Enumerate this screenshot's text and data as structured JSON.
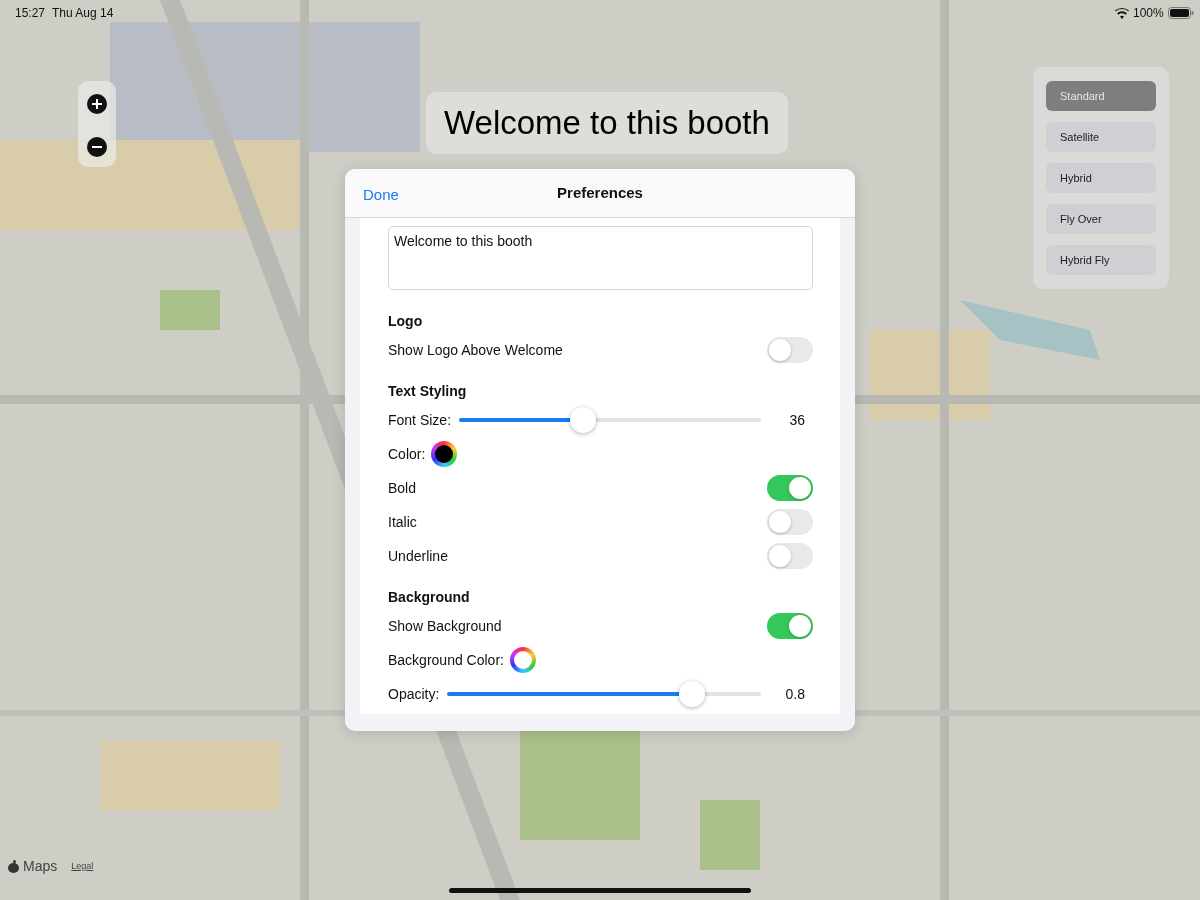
{
  "status_bar": {
    "time": "15:27",
    "date": "Thu Aug 14",
    "battery": "100%"
  },
  "banner": {
    "text": "Welcome to this booth"
  },
  "map_types": [
    {
      "label": "Standard",
      "selected": true
    },
    {
      "label": "Satellite",
      "selected": false
    },
    {
      "label": "Hybrid",
      "selected": false
    },
    {
      "label": "Fly Over",
      "selected": false
    },
    {
      "label": "Hybrid Fly",
      "selected": false
    }
  ],
  "preferences": {
    "done": "Done",
    "title": "Preferences",
    "welcome_text": "Welcome to this booth",
    "sections": [
      {
        "heading": "Logo",
        "rows": [
          {
            "kind": "toggle",
            "label": "Show Logo Above Welcome",
            "on": false
          }
        ]
      },
      {
        "heading": "Text Styling",
        "rows": [
          {
            "kind": "slider",
            "label": "Font Size:",
            "level": 0.41,
            "reading": "36"
          },
          {
            "kind": "color",
            "label": "Color:",
            "color": "#000000"
          },
          {
            "kind": "toggle",
            "label": "Bold",
            "on": true
          },
          {
            "kind": "toggle",
            "label": "Italic",
            "on": false
          },
          {
            "kind": "toggle",
            "label": "Underline",
            "on": false
          }
        ]
      },
      {
        "heading": "Background",
        "rows": [
          {
            "kind": "toggle",
            "label": "Show Background",
            "on": true
          },
          {
            "kind": "color",
            "label": "Background Color:",
            "color": "#ffffff"
          },
          {
            "kind": "slider",
            "label": "Opacity:",
            "level": 0.78,
            "reading": "0.8"
          }
        ]
      }
    ]
  },
  "map_footer": {
    "brand": "Maps",
    "legal": "Legal"
  }
}
